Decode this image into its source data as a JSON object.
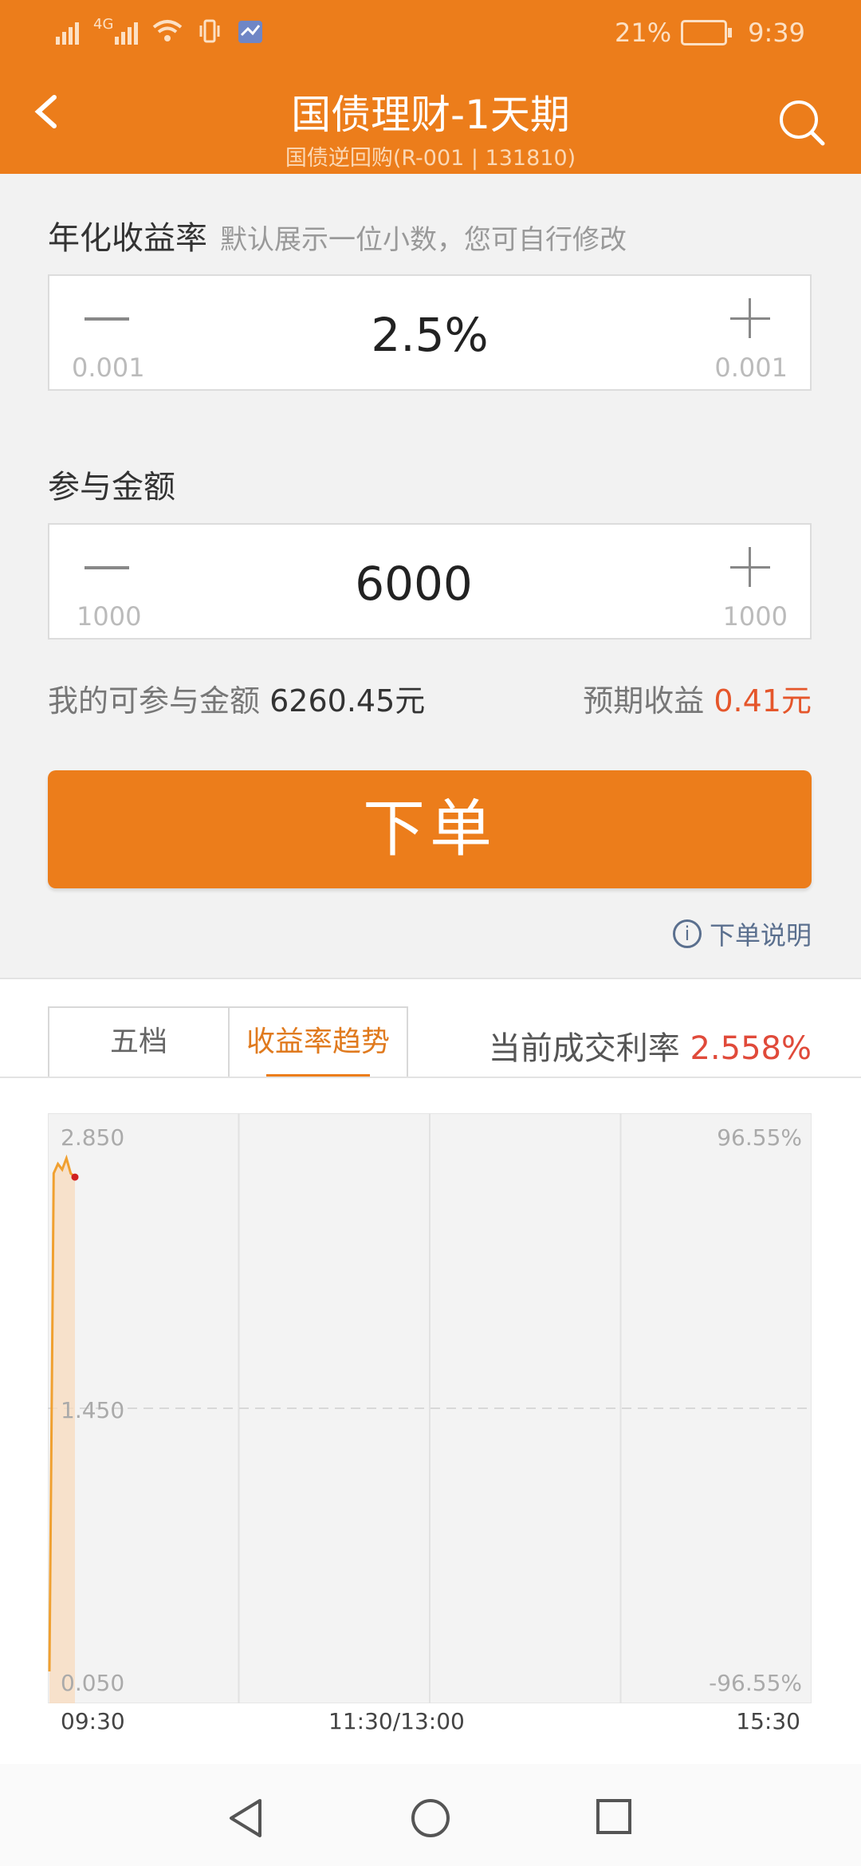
{
  "status_bar": {
    "network": "4G",
    "battery_pct": "21%",
    "time": "9:39",
    "icons": [
      "signal-icon",
      "signal-4g-icon",
      "wifi-icon",
      "vibrate-icon",
      "app-notification-icon",
      "battery-icon"
    ]
  },
  "header": {
    "title": "国债理财-1天期",
    "subtitle": "国债逆回购(R-001 | 131810)",
    "back_icon": "chevron-left-icon",
    "search_icon": "search-icon",
    "color": "#ec7d1b"
  },
  "rate_field": {
    "label": "年化收益率",
    "hint": "默认展示一位小数，您可自行修改",
    "value": "2.5%",
    "step_minus": "0.001",
    "step_plus": "0.001"
  },
  "amount_field": {
    "label": "参与金额",
    "value": "6000",
    "step_minus": "1000",
    "step_plus": "1000"
  },
  "summary": {
    "available_label": "我的可参与金额",
    "available_value": "6260.45元",
    "expected_label": "预期收益",
    "expected_value": "0.41元"
  },
  "order_button": "下单",
  "order_explain": "下单说明",
  "tabs": [
    {
      "label": "五档",
      "active": false
    },
    {
      "label": "收益率趋势",
      "active": true
    }
  ],
  "current_rate": {
    "label": "当前成交利率",
    "value": "2.558%"
  },
  "chart_data": {
    "type": "line",
    "y_left_ticks": [
      "2.850",
      "1.450",
      "0.050"
    ],
    "y_right_ticks": [
      "96.55%",
      "-96.55%"
    ],
    "x_ticks": [
      "09:30",
      "11:30/13:00",
      "15:30"
    ],
    "ylim": [
      0.05,
      2.85
    ],
    "series": [
      {
        "color": "#f0a030",
        "x": [
          "09:30",
          "09:30",
          "09:31",
          "09:32",
          "09:33",
          "09:34",
          "09:35"
        ],
        "values": [
          0.05,
          2.7,
          2.75,
          2.72,
          2.78,
          2.7,
          2.68
        ]
      }
    ],
    "last_point_color": "#d02020",
    "grid": true
  },
  "nav_bar": {
    "icons": [
      "back-triangle-icon",
      "home-circle-icon",
      "recents-square-icon"
    ]
  }
}
